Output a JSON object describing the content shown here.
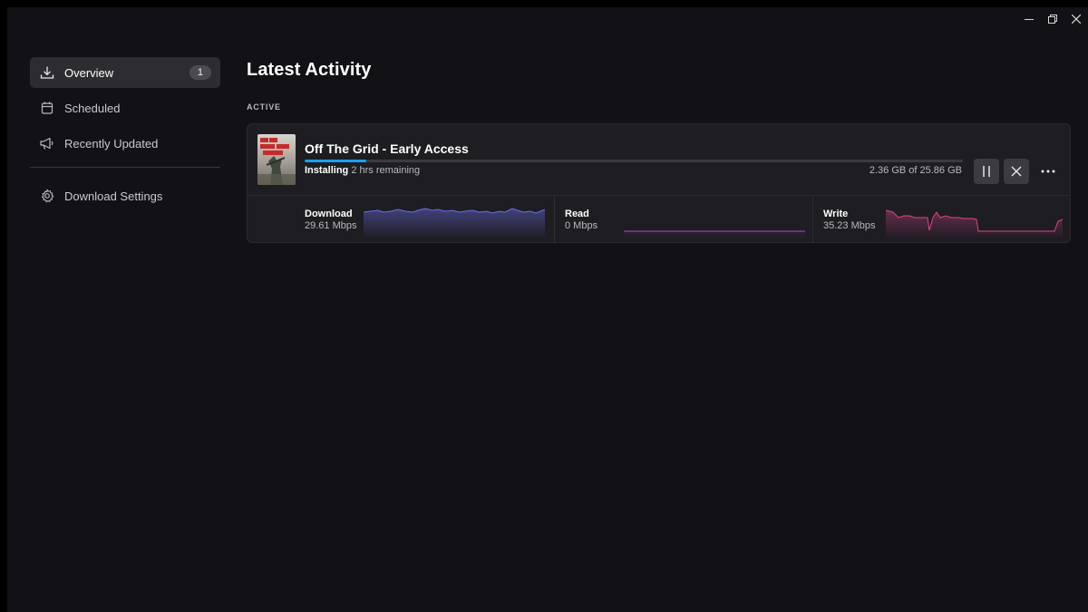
{
  "window": {
    "controls": {
      "minimize_icon": "minimize-icon",
      "restore_icon": "restore-icon",
      "close_icon": "close-icon"
    }
  },
  "sidebar": {
    "items": [
      {
        "label": "Overview",
        "icon": "download-icon",
        "badge": "1",
        "active": true
      },
      {
        "label": "Scheduled",
        "icon": "calendar-icon"
      },
      {
        "label": "Recently Updated",
        "icon": "megaphone-icon"
      }
    ],
    "settings": {
      "label": "Download Settings",
      "icon": "gear-icon"
    }
  },
  "main": {
    "title": "Latest Activity",
    "section_label": "ACTIVE",
    "active_download": {
      "game_title": "Off The Grid - Early Access",
      "progress_fraction": 0.094,
      "status_strong": "Installing",
      "status_rest": "2 hrs remaining",
      "size_text": "2.36 GB of 25.86 GB",
      "accent": "#1a9fff",
      "stats": {
        "download": {
          "label": "Download",
          "value": "29.61 Mbps",
          "color": "#6b6ee8"
        },
        "read": {
          "label": "Read",
          "value": "0 Mbps",
          "color": "#c03fc6"
        },
        "write": {
          "label": "Write",
          "value": "35.23 Mbps",
          "color": "#d9458f"
        }
      }
    }
  }
}
